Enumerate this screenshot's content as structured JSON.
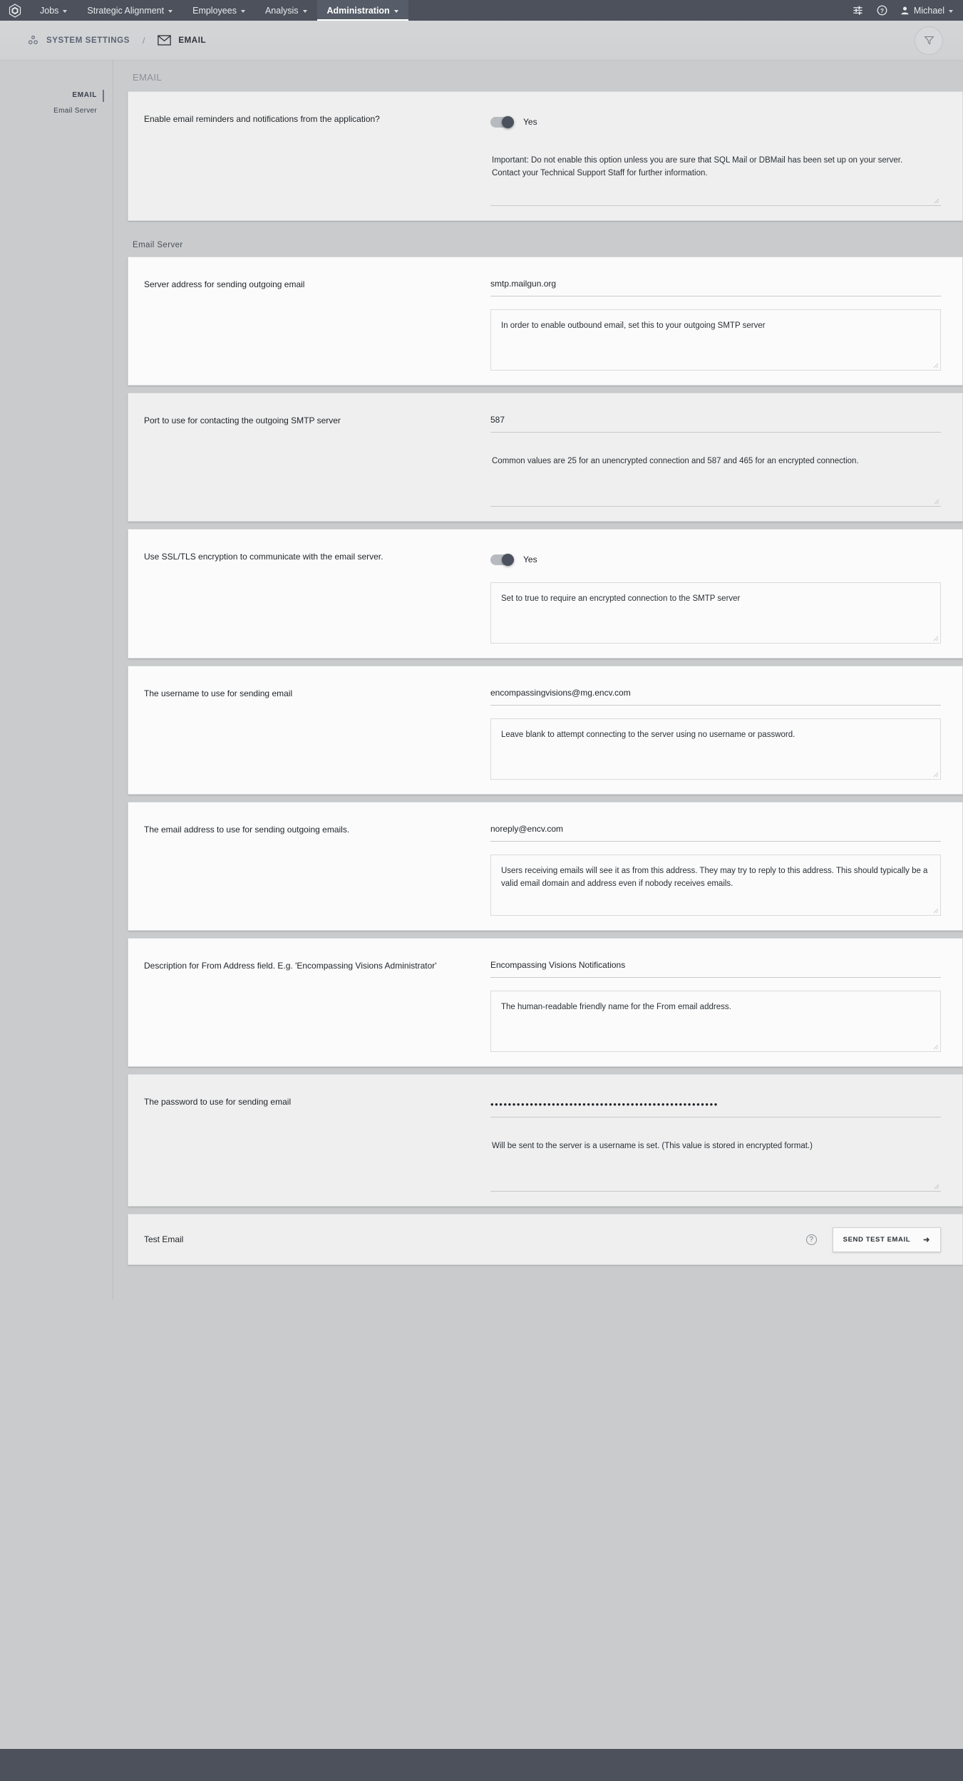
{
  "topnav": {
    "logo": "hexagon-logo",
    "items": [
      {
        "label": "Jobs",
        "active": false
      },
      {
        "label": "Strategic Alignment",
        "active": false
      },
      {
        "label": "Employees",
        "active": false
      },
      {
        "label": "Analysis",
        "active": false
      },
      {
        "label": "Administration",
        "active": true
      }
    ],
    "sliders_icon": "sliders-icon",
    "help_icon": "help-icon",
    "user_name": "Michael"
  },
  "breadcrumb": {
    "root_icon": "settings-gears-icon",
    "root": "SYSTEM SETTINGS",
    "separator": "/",
    "current_icon": "envelope-icon",
    "current": "EMAIL",
    "filter_icon": "filter-icon"
  },
  "sidebar": {
    "items": [
      {
        "label": "EMAIL",
        "active": true
      },
      {
        "label": "Email Server",
        "active": false
      }
    ]
  },
  "main": {
    "page_heading": "EMAIL",
    "server_section_heading": "Email Server",
    "settings": [
      {
        "label": "Enable email reminders and notifications from the application?",
        "control": "toggle",
        "toggle_state": "Yes",
        "description": "Important: Do not enable this option unless you are sure that SQL Mail or DBMail has been set up on your server. Contact your Technical Support Staff for further information."
      },
      {
        "label": "Server address for sending outgoing email",
        "control": "text",
        "value": "smtp.mailgun.org",
        "description": "In order to enable outbound email, set this to your outgoing SMTP server"
      },
      {
        "label": "Port to use for contacting the outgoing SMTP server",
        "control": "text",
        "value": "587",
        "description": "Common values are 25 for an unencrypted connection and 587 and 465 for an encrypted connection."
      },
      {
        "label": "Use SSL/TLS encryption to communicate with the email server.",
        "control": "toggle",
        "toggle_state": "Yes",
        "description": "Set to true to require an encrypted connection to the SMTP server"
      },
      {
        "label": "The username to use for sending email",
        "control": "text",
        "value": "encompassingvisions@mg.encv.com",
        "description": "Leave blank to attempt connecting to the server using no username or password."
      },
      {
        "label": "The email address to use for sending outgoing emails.",
        "control": "text",
        "value": "noreply@encv.com",
        "description": "Users receiving emails will see it as from this address.  They may try to reply to this address.  This should typically be a valid email domain and address even if nobody receives emails."
      },
      {
        "label": "Description for From Address field. E.g. 'Encompassing Visions Administrator'",
        "control": "text",
        "value": "Encompassing Visions Notifications",
        "description": "The human-readable friendly name for the From email address."
      },
      {
        "label": "The password to use for sending email",
        "control": "password",
        "value": "••••••••••••••••••••••••••••••••••••••••••••••••••••",
        "description": "Will be sent to the server is a username is set.  (This value is stored in encrypted format.)"
      }
    ],
    "test_email": {
      "label": "Test Email",
      "help_icon": "help-circle-icon",
      "button_label": "SEND TEST EMAIL",
      "button_icon": "arrow-right-icon"
    }
  },
  "colors": {
    "navbar": "#4c515c",
    "page_bg": "#c9cbcd",
    "card_bg": "#fbfbfb",
    "card_alt_bg": "#efefef",
    "toggle_knob": "#4b515d"
  }
}
